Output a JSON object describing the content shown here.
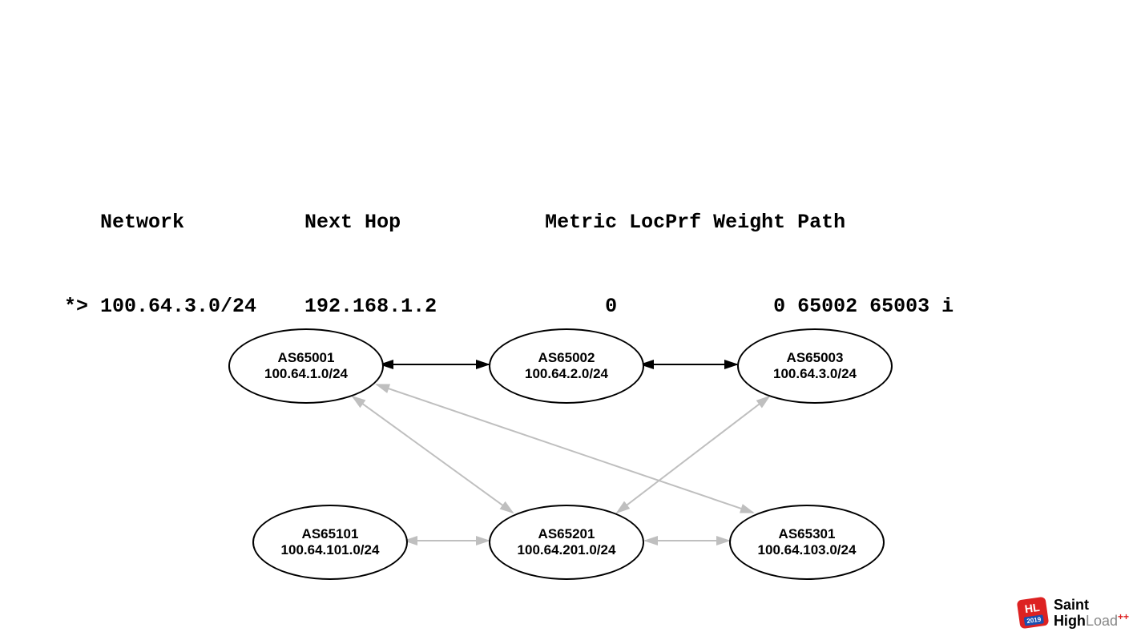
{
  "route_table": {
    "header": "   Network          Next Hop            Metric LocPrf Weight Path",
    "row": "*> 100.64.3.0/24    192.168.1.2              0             0 65002 65003 i"
  },
  "nodes": {
    "n1": {
      "as": "AS65001",
      "net": "100.64.1.0/24"
    },
    "n2": {
      "as": "AS65002",
      "net": "100.64.2.0/24"
    },
    "n3": {
      "as": "AS65003",
      "net": "100.64.3.0/24"
    },
    "n4": {
      "as": "AS65101",
      "net": "100.64.101.0/24"
    },
    "n5": {
      "as": "AS65201",
      "net": "100.64.201.0/24"
    },
    "n6": {
      "as": "AS65301",
      "net": "100.64.103.0/24"
    }
  },
  "edges": [
    {
      "from": "n1",
      "to": "n2",
      "style": "dark",
      "double": true
    },
    {
      "from": "n2",
      "to": "n3",
      "style": "dark",
      "double": true
    },
    {
      "from": "n1",
      "to": "n5",
      "style": "light",
      "double": true
    },
    {
      "from": "n1",
      "to": "n6",
      "style": "light",
      "double": true
    },
    {
      "from": "n3",
      "to": "n5",
      "style": "light",
      "double": true
    },
    {
      "from": "n4",
      "to": "n5",
      "style": "light",
      "double": true
    },
    {
      "from": "n5",
      "to": "n6",
      "style": "light",
      "double": true
    }
  ],
  "logo": {
    "badge": "HL",
    "year": "2019",
    "line1a": "Saint",
    "line2a": "High",
    "line2b": "Load",
    "plus": "++"
  }
}
